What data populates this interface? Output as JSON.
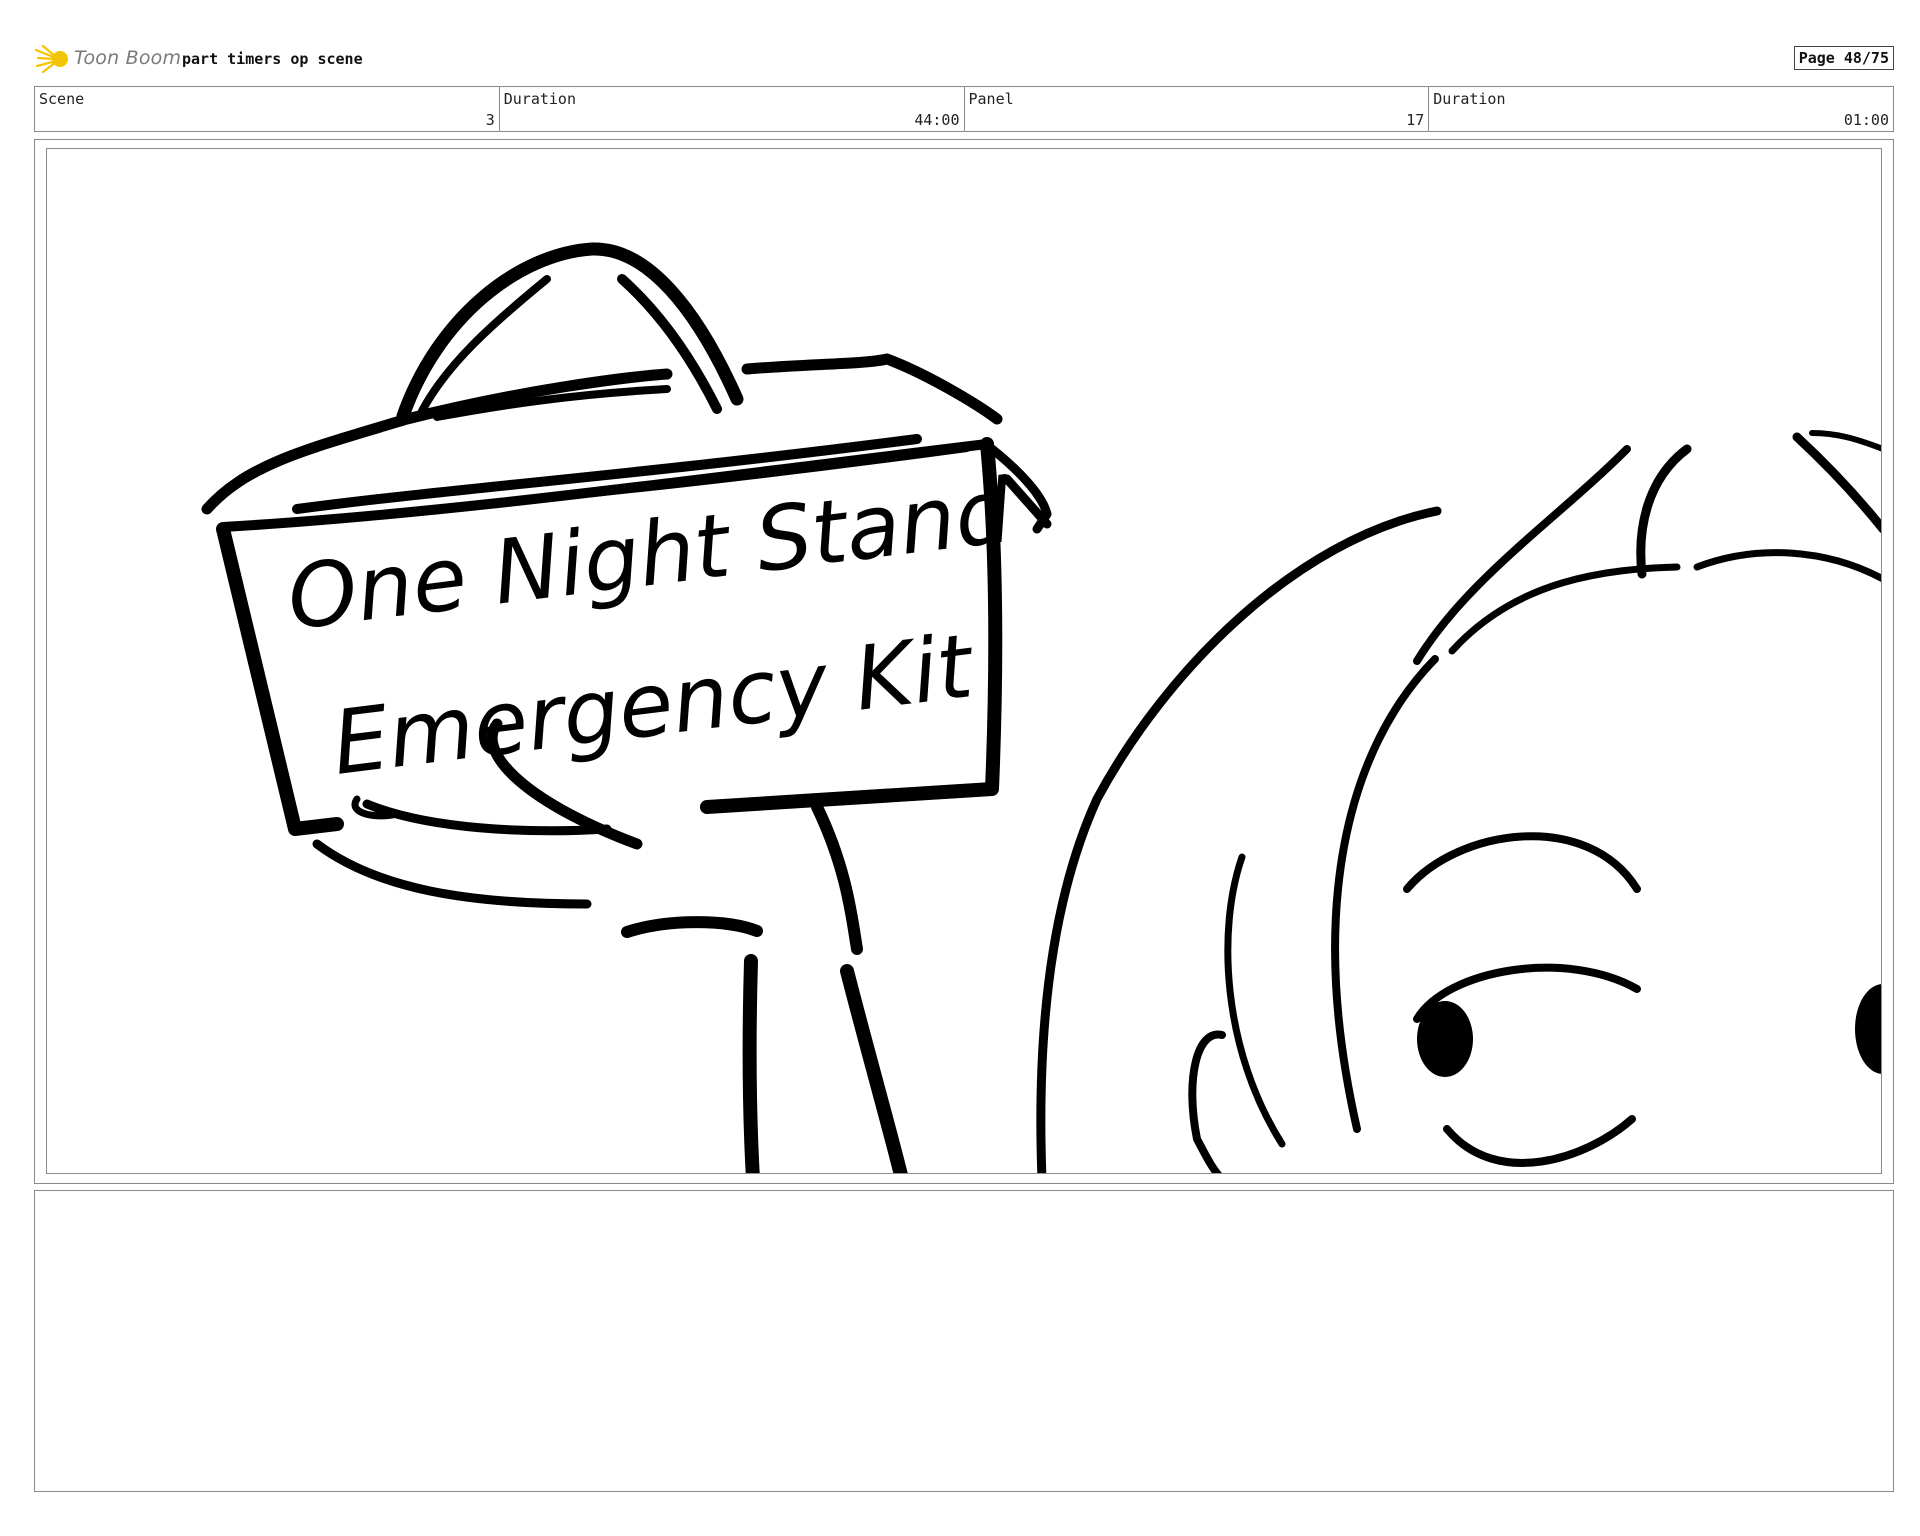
{
  "header": {
    "brand": "Toon Boom",
    "project_title": "part timers op scene",
    "page_label": "Page 48/75"
  },
  "info": {
    "scene_label": "Scene",
    "scene_value": "3",
    "scene_duration_label": "Duration",
    "scene_duration_value": "44:00",
    "panel_label": "Panel",
    "panel_value": "17",
    "panel_duration_label": "Duration",
    "panel_duration_value": "01:00"
  },
  "drawing": {
    "box_text_line1": "One Night Stand",
    "box_text_line2": "Emergency Kit"
  },
  "colors": {
    "logo_yellow": "#f5c400",
    "brand_gray": "#7a7a7a",
    "border_gray": "#8a8a8a"
  }
}
